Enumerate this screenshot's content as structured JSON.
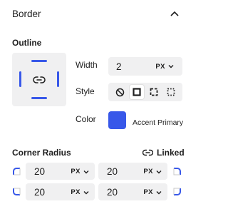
{
  "panel": {
    "title": "Border"
  },
  "outline": {
    "label": "Outline",
    "width": {
      "label": "Width",
      "value": "2",
      "unit": "PX"
    },
    "style": {
      "label": "Style",
      "options": [
        "none",
        "solid",
        "dashed",
        "dotted"
      ],
      "selected": "solid"
    },
    "color": {
      "label": "Color",
      "name": "Accent Primary",
      "hex": "#3858e9"
    }
  },
  "corner_radius": {
    "label": "Corner Radius",
    "linked_label": "Linked",
    "top_left": {
      "value": "20",
      "unit": "PX"
    },
    "top_right": {
      "value": "20",
      "unit": "PX"
    },
    "bottom_left": {
      "value": "20",
      "unit": "PX"
    },
    "bottom_right": {
      "value": "20",
      "unit": "PX"
    }
  },
  "colors": {
    "accent": "#3858e9",
    "field_bg": "#f0f0f1",
    "text": "#1e1e1e"
  }
}
